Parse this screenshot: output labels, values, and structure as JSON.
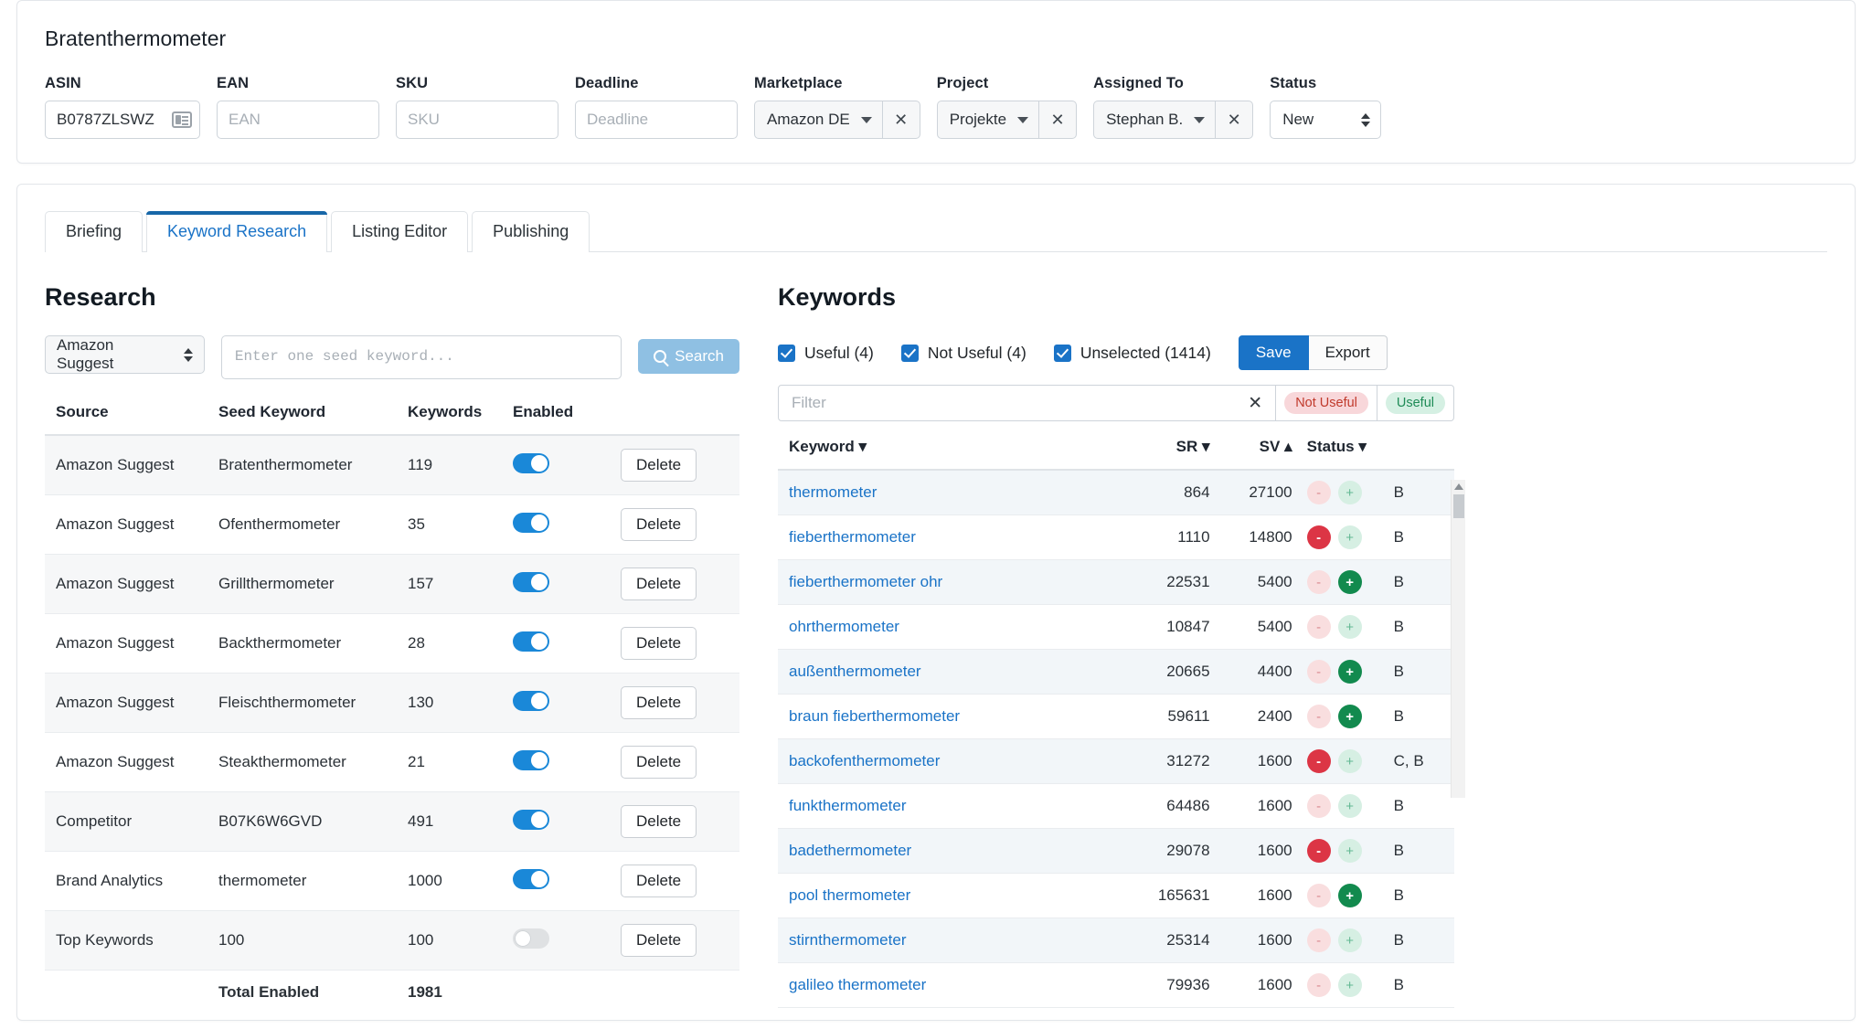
{
  "header": {
    "title": "Bratenthermometer",
    "fields": [
      {
        "label": "ASIN",
        "value": "B0787ZLSWZ",
        "placeholder": "ASIN",
        "icon": "id-card-icon"
      },
      {
        "label": "EAN",
        "value": "",
        "placeholder": "EAN"
      },
      {
        "label": "SKU",
        "value": "",
        "placeholder": "SKU"
      },
      {
        "label": "Deadline",
        "value": "",
        "placeholder": "Deadline"
      }
    ],
    "marketplace": {
      "label": "Marketplace",
      "value": "Amazon DE",
      "clear": "✕"
    },
    "project": {
      "label": "Project",
      "value": "Projekte",
      "clear": "✕"
    },
    "assigned_to": {
      "label": "Assigned To",
      "value": "Stephan B.",
      "clear": "✕"
    },
    "status": {
      "label": "Status",
      "value": "New"
    }
  },
  "tabs": [
    {
      "label": "Briefing",
      "active": false
    },
    {
      "label": "Keyword Research",
      "active": true
    },
    {
      "label": "Listing Editor",
      "active": false
    },
    {
      "label": "Publishing",
      "active": false
    }
  ],
  "research": {
    "title": "Research",
    "source_select": "Amazon Suggest",
    "seed_placeholder": "Enter one seed keyword...",
    "search_label": "Search",
    "columns": [
      "Source",
      "Seed Keyword",
      "Keywords",
      "Enabled",
      ""
    ],
    "delete_label": "Delete",
    "rows": [
      {
        "source": "Amazon Suggest",
        "seed": "Bratenthermometer",
        "keywords": "119",
        "enabled": true
      },
      {
        "source": "Amazon Suggest",
        "seed": "Ofenthermometer",
        "keywords": "35",
        "enabled": true
      },
      {
        "source": "Amazon Suggest",
        "seed": "Grillthermometer",
        "keywords": "157",
        "enabled": true
      },
      {
        "source": "Amazon Suggest",
        "seed": "Backthermometer",
        "keywords": "28",
        "enabled": true
      },
      {
        "source": "Amazon Suggest",
        "seed": "Fleischthermometer",
        "keywords": "130",
        "enabled": true
      },
      {
        "source": "Amazon Suggest",
        "seed": "Steakthermometer",
        "keywords": "21",
        "enabled": true
      },
      {
        "source": "Competitor",
        "seed": "B07K6W6GVD",
        "keywords": "491",
        "enabled": true
      },
      {
        "source": "Brand Analytics",
        "seed": "thermometer",
        "keywords": "1000",
        "enabled": true
      },
      {
        "source": "Top Keywords",
        "seed": "100",
        "keywords": "100",
        "enabled": false
      }
    ],
    "total_label": "Total Enabled",
    "total_value": "1981"
  },
  "keywords": {
    "title": "Keywords",
    "filters": [
      {
        "label": "Useful (4)",
        "checked": true
      },
      {
        "label": "Not Useful (4)",
        "checked": true
      },
      {
        "label": "Unselected (1414)",
        "checked": true
      }
    ],
    "save_label": "Save",
    "export_label": "Export",
    "filter_placeholder": "Filter",
    "filter_clear": "✕",
    "pill_not_useful": "Not Useful",
    "pill_useful": "Useful",
    "columns": {
      "keyword": "Keyword",
      "sr": "SR",
      "sv": "SV",
      "status": "Status",
      "keyword_sort": "▾",
      "sr_sort": "▾",
      "sv_sort": "▴",
      "status_sort": "▾"
    },
    "minus_glyph": "-",
    "plus_glyph": "+",
    "rows": [
      {
        "keyword": "thermometer",
        "sr": "864",
        "sv": "27100",
        "minus": "dim",
        "plus": "dim",
        "status": "B"
      },
      {
        "keyword": "fieberthermometer",
        "sr": "1110",
        "sv": "14800",
        "minus": "on",
        "plus": "dim",
        "status": "B"
      },
      {
        "keyword": "fieberthermometer ohr",
        "sr": "22531",
        "sv": "5400",
        "minus": "dim",
        "plus": "on",
        "status": "B"
      },
      {
        "keyword": "ohrthermometer",
        "sr": "10847",
        "sv": "5400",
        "minus": "dim",
        "plus": "dim",
        "status": "B"
      },
      {
        "keyword": "außenthermometer",
        "sr": "20665",
        "sv": "4400",
        "minus": "dim",
        "plus": "on",
        "status": "B"
      },
      {
        "keyword": "braun fieberthermometer",
        "sr": "59611",
        "sv": "2400",
        "minus": "dim",
        "plus": "on",
        "status": "B"
      },
      {
        "keyword": "backofenthermometer",
        "sr": "31272",
        "sv": "1600",
        "minus": "on",
        "plus": "dim",
        "status": "C, B"
      },
      {
        "keyword": "funkthermometer",
        "sr": "64486",
        "sv": "1600",
        "minus": "dim",
        "plus": "dim",
        "status": "B"
      },
      {
        "keyword": "badethermometer",
        "sr": "29078",
        "sv": "1600",
        "minus": "on",
        "plus": "dim",
        "status": "B"
      },
      {
        "keyword": "pool thermometer",
        "sr": "165631",
        "sv": "1600",
        "minus": "dim",
        "plus": "on",
        "status": "B"
      },
      {
        "keyword": "stirnthermometer",
        "sr": "25314",
        "sv": "1600",
        "minus": "dim",
        "plus": "dim",
        "status": "B"
      },
      {
        "keyword": "galileo thermometer",
        "sr": "79936",
        "sv": "1600",
        "minus": "dim",
        "plus": "dim",
        "status": "B"
      }
    ]
  }
}
